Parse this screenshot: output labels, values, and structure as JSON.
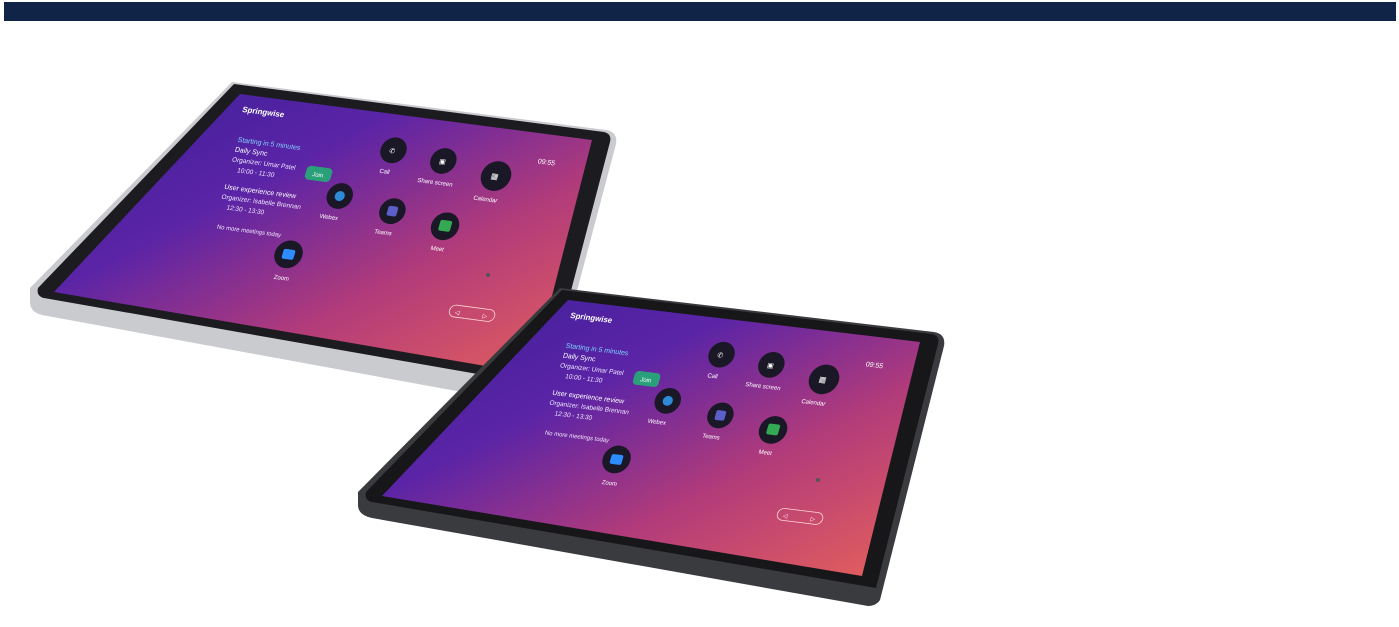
{
  "colors": {
    "header_bar": "#0f2446",
    "screen_gradient": [
      "#3a1f9a",
      "#6a2aa8",
      "#c2436e",
      "#e85f5a"
    ],
    "join_button": "#2aa07a",
    "light_bezel": "#c9cbcf",
    "dark_bezel": "#3a3b3f"
  },
  "devices": [
    {
      "variant": "light",
      "screen": {
        "room_name": "Springwise",
        "time": "09:55",
        "meetings": [
          {
            "status": "Starting in 5 minutes",
            "title": "Daily Sync",
            "organizer": "Organizer: Umar Patel",
            "time": "10:00 - 11:30"
          },
          {
            "status": "",
            "title": "User experience review",
            "organizer": "Organizer: Isabelle Brennan",
            "time": "12:30 - 13:30"
          }
        ],
        "no_more_meetings": "No more meetings today",
        "join_label": "Join",
        "apps": [
          "Call",
          "Share screen",
          "Calendar",
          "Webex",
          "Teams",
          "Meet",
          "Zoom"
        ]
      }
    },
    {
      "variant": "dark",
      "screen": {
        "room_name": "Springwise",
        "time": "09:55",
        "meetings": [
          {
            "status": "Starting in 5 minutes",
            "title": "Daily Sync",
            "organizer": "Organizer: Umar Patel",
            "time": "10:00 - 11:30"
          },
          {
            "status": "",
            "title": "User experience review",
            "organizer": "Organizer: Isabelle Brennan",
            "time": "12:30 - 13:30"
          }
        ],
        "no_more_meetings": "No more meetings today",
        "join_label": "Join",
        "apps": [
          "Call",
          "Share screen",
          "Calendar",
          "Webex",
          "Teams",
          "Meet",
          "Zoom"
        ]
      }
    }
  ]
}
